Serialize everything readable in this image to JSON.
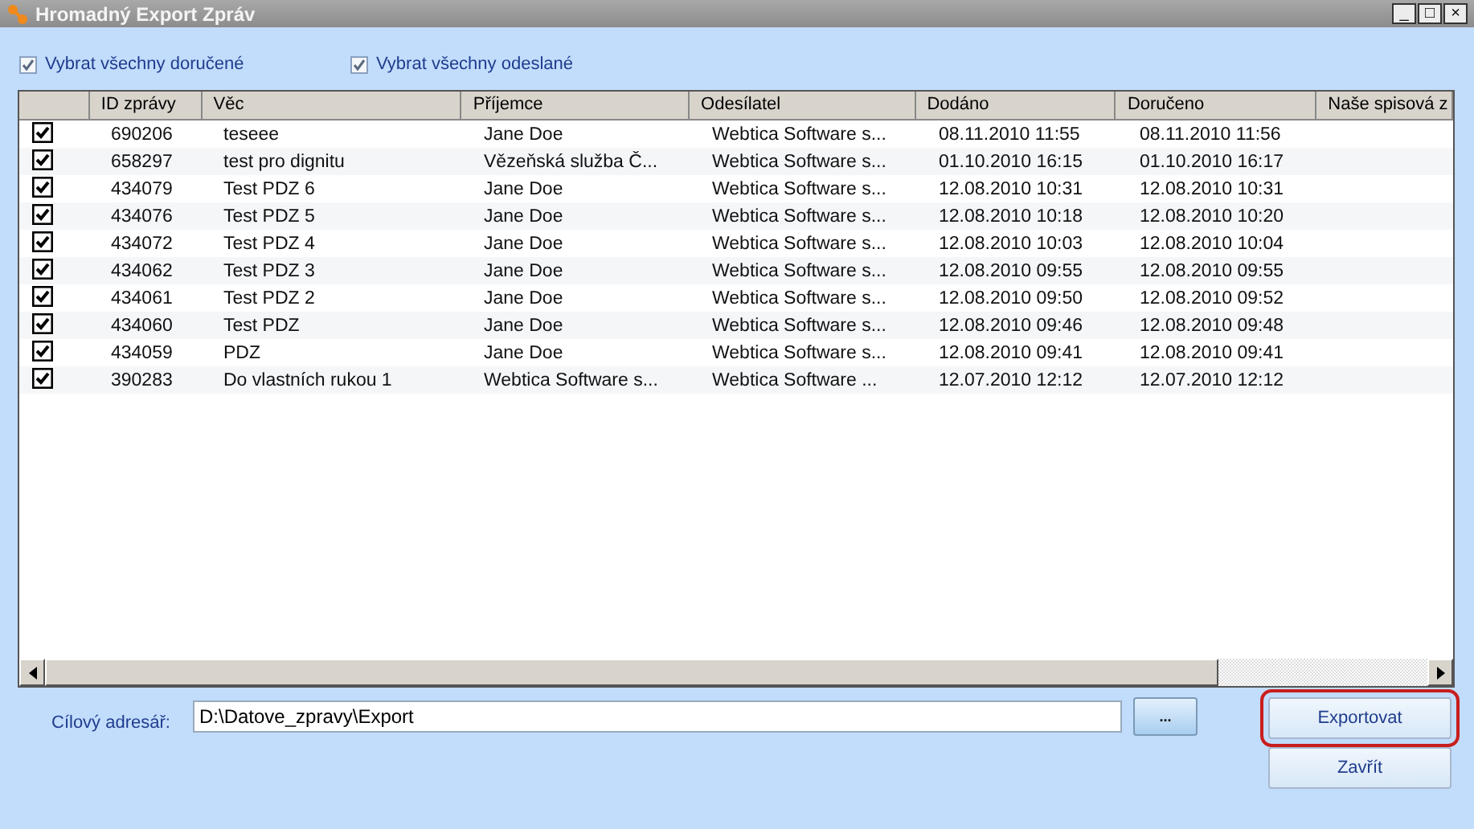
{
  "window": {
    "title": "Hromadný Export Zpráv",
    "controls": [
      "_",
      "□",
      "×"
    ]
  },
  "select_all": [
    {
      "label": "Vybrat všechny doručené",
      "checked": true
    },
    {
      "label": "Vybrat všechny odeslané",
      "checked": true
    }
  ],
  "table": {
    "columns": [
      "ID zprávy",
      "Věc",
      "Příjemce",
      "Odesílatel",
      "Dodáno",
      "Doručeno",
      "Naše spisová z"
    ],
    "rows": [
      {
        "checked": true,
        "cells": [
          "690206",
          "teseee",
          "Jane Doe",
          "Webtica Software s...",
          "08.11.2010 11:55",
          "08.11.2010 11:56"
        ]
      },
      {
        "checked": true,
        "cells": [
          "658297",
          "test pro dignitu",
          "Vězeňská služba Č...",
          "Webtica Software s...",
          "01.10.2010 16:15",
          "01.10.2010 16:17"
        ]
      },
      {
        "checked": true,
        "cells": [
          "434079",
          "Test PDZ 6",
          "Jane Doe",
          "Webtica Software s...",
          "12.08.2010 10:31",
          "12.08.2010 10:31"
        ]
      },
      {
        "checked": true,
        "cells": [
          "434076",
          "Test PDZ 5",
          "Jane Doe",
          "Webtica Software s...",
          "12.08.2010 10:18",
          "12.08.2010 10:20"
        ]
      },
      {
        "checked": true,
        "cells": [
          "434072",
          "Test PDZ 4",
          "Jane Doe",
          "Webtica Software s...",
          "12.08.2010 10:03",
          "12.08.2010 10:04"
        ]
      },
      {
        "checked": true,
        "cells": [
          "434062",
          "Test PDZ 3",
          "Jane Doe",
          "Webtica Software s...",
          "12.08.2010 09:55",
          "12.08.2010 09:55"
        ]
      },
      {
        "checked": true,
        "cells": [
          "434061",
          "Test PDZ 2",
          "Jane Doe",
          "Webtica Software s...",
          "12.08.2010 09:50",
          "12.08.2010 09:52"
        ]
      },
      {
        "checked": true,
        "cells": [
          "434060",
          "Test PDZ",
          "Jane Doe",
          "Webtica Software s...",
          "12.08.2010 09:46",
          "12.08.2010 09:48"
        ]
      },
      {
        "checked": true,
        "cells": [
          "434059",
          "PDZ",
          "Jane Doe",
          "Webtica Software s...",
          "12.08.2010 09:41",
          "12.08.2010 09:41"
        ]
      },
      {
        "checked": true,
        "cells": [
          "390283",
          "Do vlastních rukou 1",
          "Webtica Software s...",
          "Webtica Software ...",
          "12.07.2010 12:12",
          "12.07.2010 12:12"
        ]
      }
    ]
  },
  "target": {
    "label": "Cílový adresář:",
    "value": "D:\\Datove_zpravy\\Export",
    "browse": "..."
  },
  "buttons": [
    {
      "label": "Exportovat",
      "highlighted": true
    },
    {
      "label": "Zavřít",
      "highlighted": false
    }
  ]
}
